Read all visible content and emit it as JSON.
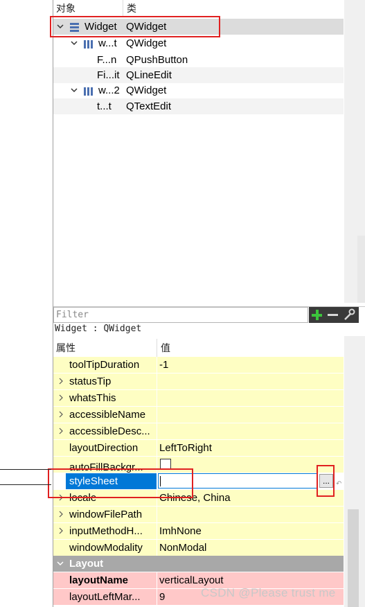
{
  "object_inspector": {
    "header": {
      "col_object": "对象",
      "col_class": "类"
    },
    "rows": [
      {
        "name": "Widget",
        "class": "QWidget"
      },
      {
        "name": "w...t",
        "class": "QWidget"
      },
      {
        "name": "F...n",
        "class": "QPushButton"
      },
      {
        "name": "Fi...it",
        "class": "QLineEdit"
      },
      {
        "name": "w...2",
        "class": "QWidget"
      },
      {
        "name": "t...t",
        "class": "QTextEdit"
      }
    ]
  },
  "property_editor": {
    "filter_placeholder": "Filter",
    "object_label": "Widget : QWidget",
    "header": {
      "col_property": "属性",
      "col_value": "值"
    },
    "rows": [
      {
        "name": "toolTipDuration",
        "value": "-1"
      },
      {
        "name": "statusTip",
        "value": ""
      },
      {
        "name": "whatsThis",
        "value": ""
      },
      {
        "name": "accessibleName",
        "value": ""
      },
      {
        "name": "accessibleDesc...",
        "value": ""
      },
      {
        "name": "layoutDirection",
        "value": "LeftToRight"
      },
      {
        "name": "autoFillBackgr...",
        "value": ""
      },
      {
        "name": "styleSheet",
        "value": ""
      },
      {
        "name": "locale",
        "value": "Chinese, China"
      },
      {
        "name": "windowFilePath",
        "value": ""
      },
      {
        "name": "inputMethodH...",
        "value": "ImhNone"
      },
      {
        "name": "windowModality",
        "value": "NonModal"
      }
    ],
    "group_layout": "Layout",
    "layout_rows": [
      {
        "name": "layoutName",
        "value": "verticalLayout"
      },
      {
        "name": "layoutLeftMar...",
        "value": "9"
      }
    ],
    "ellipsis_label": "..."
  },
  "watermark": "CSDN @Please trust me",
  "colors": {
    "highlight": "#e02020",
    "selection": "#0078d7",
    "property_bg": "#fefec3",
    "layout_group_bg": "#ffc8c8"
  }
}
